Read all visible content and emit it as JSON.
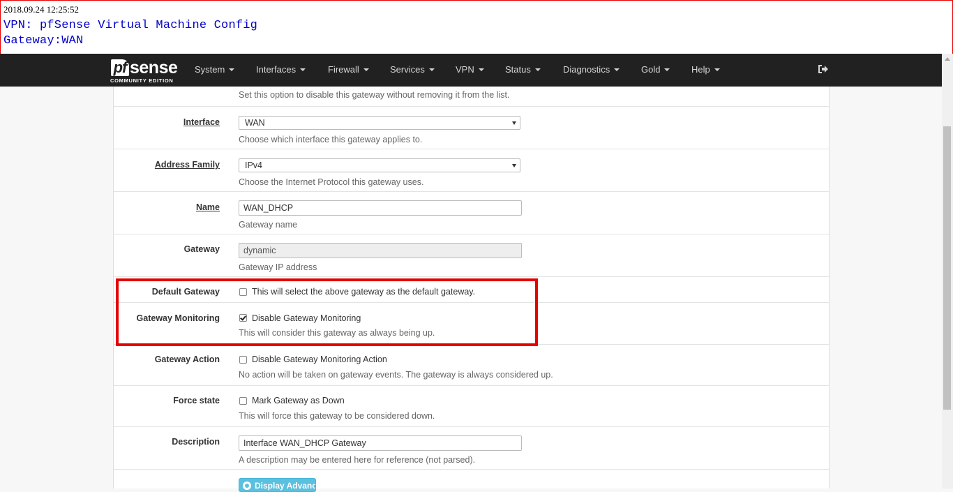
{
  "banner": {
    "timestamp": "2018.09.24 12:25:52",
    "line1": "VPN: pfSense Virtual Machine Config",
    "line2": "Gateway:WAN"
  },
  "navbar": {
    "logo_pf": "pf",
    "logo_sense": "sense",
    "logo_sub": "COMMUNITY EDITION",
    "menu": [
      {
        "label": "System"
      },
      {
        "label": "Interfaces"
      },
      {
        "label": "Firewall"
      },
      {
        "label": "Services"
      },
      {
        "label": "VPN"
      },
      {
        "label": "Status"
      },
      {
        "label": "Diagnostics"
      },
      {
        "label": "Gold"
      },
      {
        "label": "Help"
      }
    ],
    "logout_icon": "sign-out-icon"
  },
  "form": {
    "disabled_help": "Set this option to disable this gateway without removing it from the list.",
    "interface": {
      "label": "Interface",
      "value": "WAN",
      "help": "Choose which interface this gateway applies to."
    },
    "address_family": {
      "label": "Address Family",
      "value": "IPv4",
      "help": "Choose the Internet Protocol this gateway uses."
    },
    "name": {
      "label": "Name",
      "value": "WAN_DHCP",
      "help": "Gateway name"
    },
    "gateway": {
      "label": "Gateway",
      "value": "dynamic",
      "help": "Gateway IP address"
    },
    "default_gateway": {
      "label": "Default Gateway",
      "checkbox_label": "This will select the above gateway as the default gateway.",
      "checked": false
    },
    "gateway_monitoring": {
      "label": "Gateway Monitoring",
      "checkbox_label": "Disable Gateway Monitoring",
      "checked": true,
      "help": "This will consider this gateway as always being up."
    },
    "gateway_action": {
      "label": "Gateway Action",
      "checkbox_label": "Disable Gateway Monitoring Action",
      "checked": false,
      "help": "No action will be taken on gateway events. The gateway is always considered up."
    },
    "force_state": {
      "label": "Force state",
      "checkbox_label": "Mark Gateway as Down",
      "checked": false,
      "help": "This will force this gateway to be considered down."
    },
    "description": {
      "label": "Description",
      "value": "Interface WAN_DHCP Gateway",
      "help": "A description may be entered here for reference (not parsed)."
    },
    "advanced_button": "Display Advanced"
  },
  "colors": {
    "highlight": "#e60000",
    "navbar": "#212121",
    "button": "#5bc0de"
  }
}
